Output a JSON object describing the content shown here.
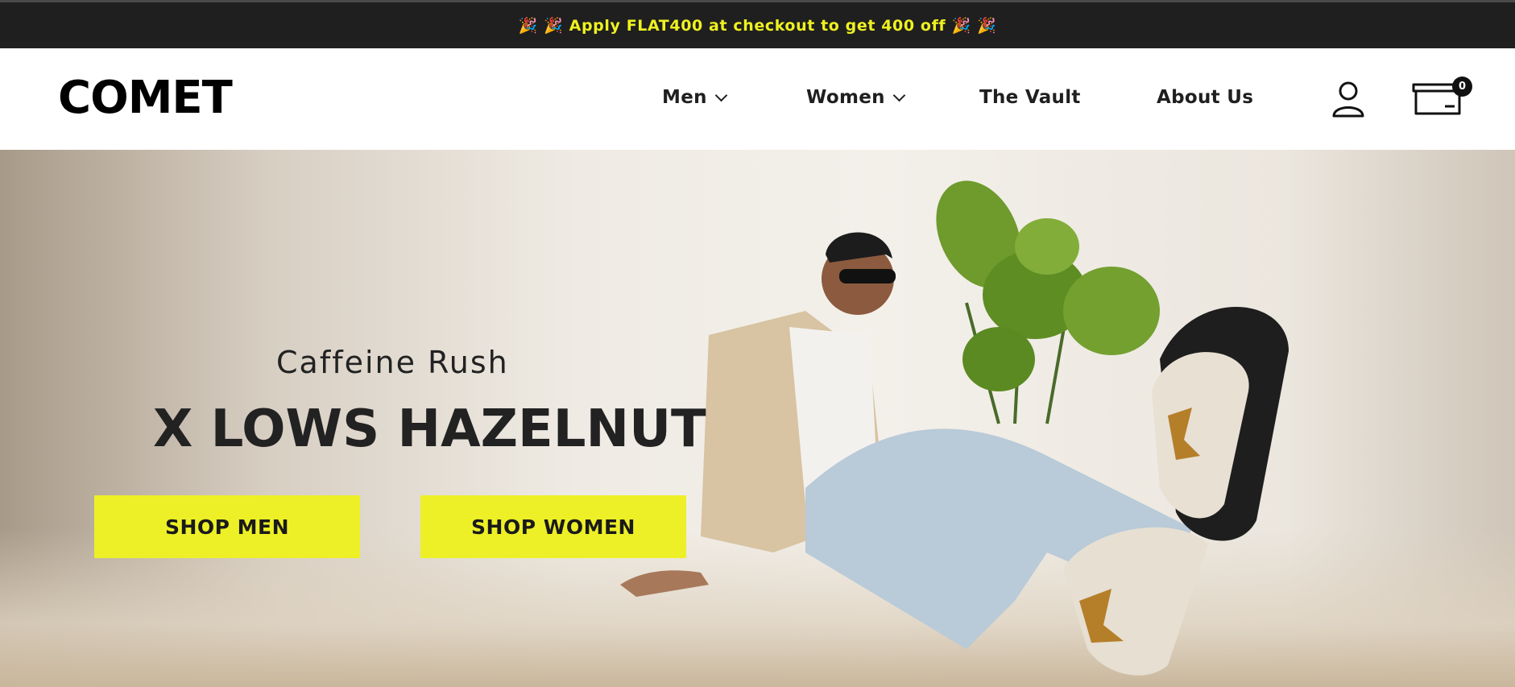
{
  "announcement": {
    "text": "🎉 🎉 Apply FLAT400 at checkout to get 400 off 🎉 🎉"
  },
  "header": {
    "logo": "COMET",
    "nav": [
      {
        "label": "Men",
        "has_dropdown": true
      },
      {
        "label": "Women",
        "has_dropdown": true
      },
      {
        "label": "The Vault",
        "has_dropdown": false
      },
      {
        "label": "About Us",
        "has_dropdown": false
      }
    ],
    "account_icon": "user-icon",
    "cart_icon": "cart-box-icon",
    "cart_count": "0"
  },
  "hero": {
    "subtitle": "Caffeine Rush",
    "title": "X LOWS HAZELNUT",
    "buttons": {
      "shop_men": "SHOP MEN",
      "shop_women": "SHOP WOMEN"
    }
  },
  "colors": {
    "accent": "#edf026",
    "announcement_bg": "#1f1f1f",
    "announcement_text": "#eef120"
  }
}
